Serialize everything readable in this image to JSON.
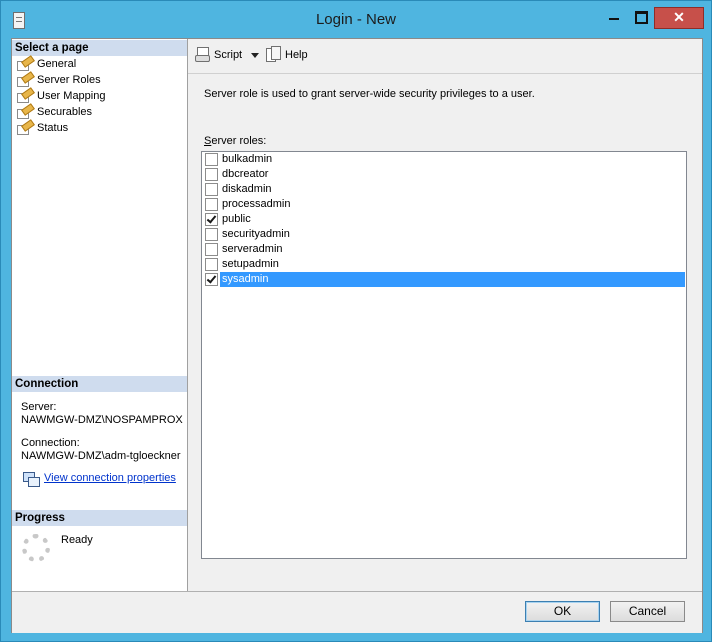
{
  "window": {
    "title": "Login - New"
  },
  "left_panel": {
    "select_page_header": "Select a page",
    "pages": [
      {
        "label": "General"
      },
      {
        "label": "Server Roles"
      },
      {
        "label": "User Mapping"
      },
      {
        "label": "Securables"
      },
      {
        "label": "Status"
      }
    ],
    "connection_header": "Connection",
    "server_label": "Server:",
    "server_value": "NAWMGW-DMZ\\NOSPAMPROX",
    "connection_label": "Connection:",
    "connection_value": "NAWMGW-DMZ\\adm-tgloeckner",
    "view_connection_link": "View connection properties",
    "progress_header": "Progress",
    "progress_status": "Ready"
  },
  "toolbar": {
    "script_label": "Script",
    "help_label": "Help"
  },
  "main": {
    "description": "Server role is used to grant server-wide security privileges to a user.",
    "roles_label_underlined": "S",
    "roles_label_rest": "erver roles:",
    "roles": [
      {
        "name": "bulkadmin",
        "checked": false
      },
      {
        "name": "dbcreator",
        "checked": false
      },
      {
        "name": "diskadmin",
        "checked": false
      },
      {
        "name": "processadmin",
        "checked": false
      },
      {
        "name": "public",
        "checked": true
      },
      {
        "name": "securityadmin",
        "checked": false
      },
      {
        "name": "serveradmin",
        "checked": false
      },
      {
        "name": "setupadmin",
        "checked": false
      },
      {
        "name": "sysadmin",
        "checked": true,
        "selected": true
      }
    ]
  },
  "buttons": {
    "ok_label": "OK",
    "cancel_label": "Cancel"
  },
  "colors": {
    "title_bar": "#4fb5e0",
    "selection": "#3399ff",
    "section_header": "#cfdcee",
    "link": "#0033cc"
  }
}
